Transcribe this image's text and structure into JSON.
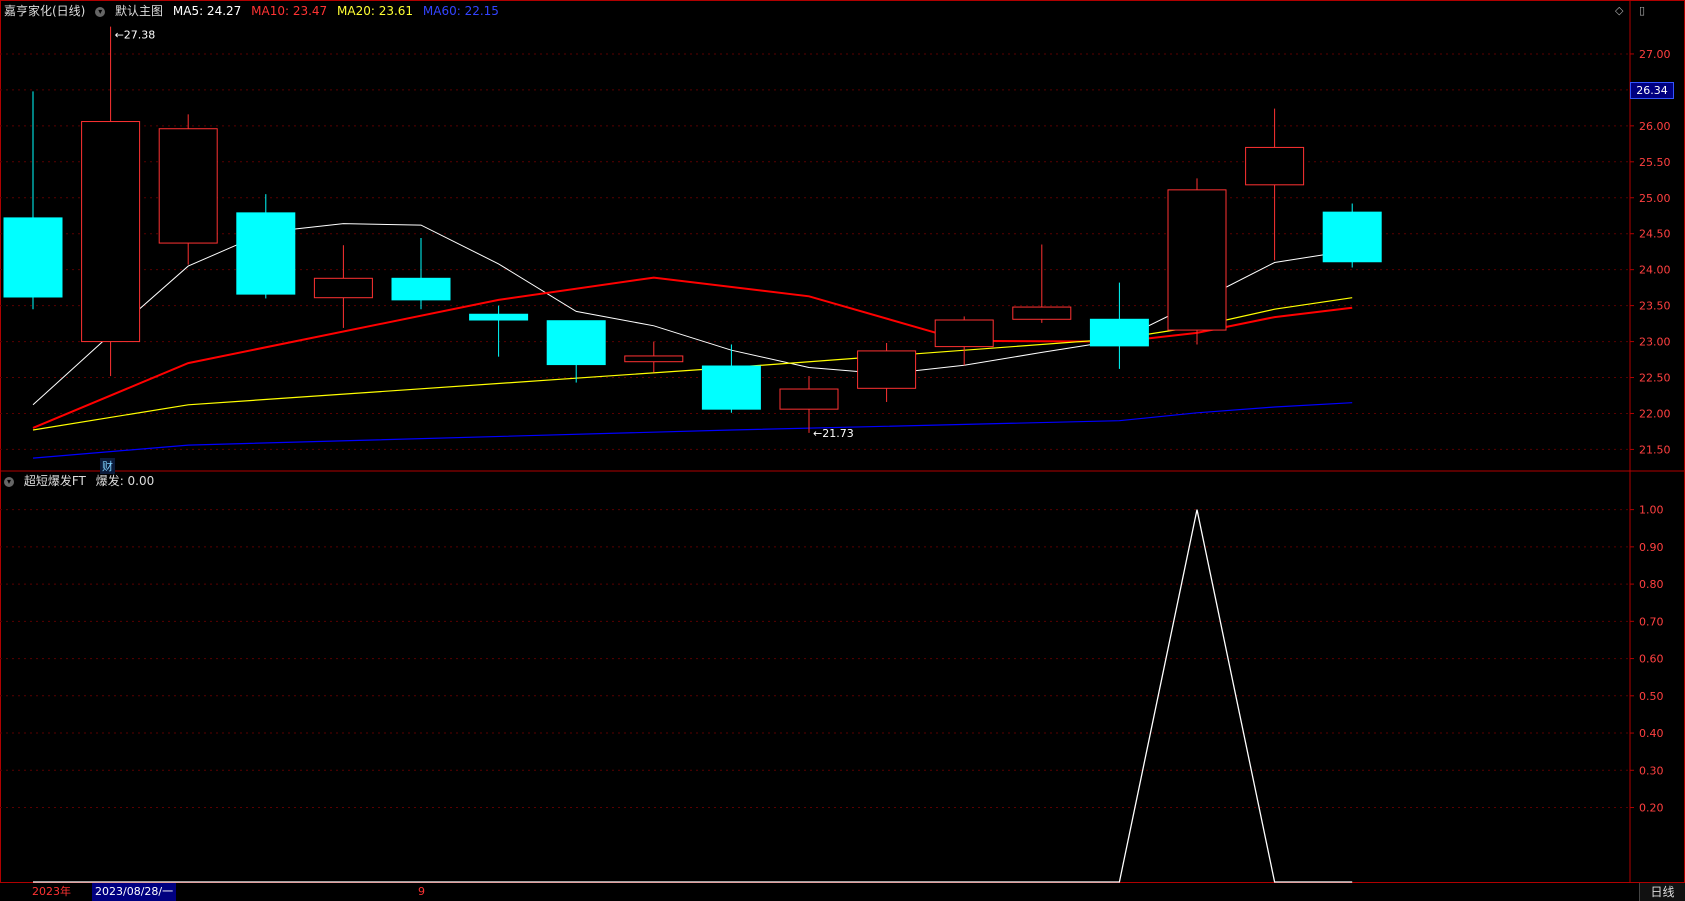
{
  "header": {
    "stock_name": "嘉亨家化(日线)",
    "main_chart_label": "默认主图",
    "ma5": "MA5: 24.27",
    "ma10": "MA10: 23.47",
    "ma20": "MA20: 23.61",
    "ma60": "MA60: 22.15"
  },
  "indicator": {
    "name": "超短爆发FT",
    "value": "爆发: 0.00"
  },
  "last_price_tag": "26.34",
  "corner_icons": [
    "diamond-icon",
    "window-icon"
  ],
  "financial_marker": "财",
  "bottom": {
    "year_label": "2023年",
    "date_label": "2023/08/28/一",
    "month_label": "9",
    "period": "日线"
  },
  "colors": {
    "background": "#000000",
    "up": "#ff3232",
    "down": "#00ffff",
    "ma5": "#ffffff",
    "ma10": "#ff0000",
    "ma20": "#ffff00",
    "ma60": "#0000ff",
    "axis": "#b00000"
  },
  "chart_data": [
    {
      "type": "candlestick",
      "title": "嘉亨家化(日线)",
      "ylim": [
        21.2,
        27.5
      ],
      "y_ticks": [
        21.5,
        22.0,
        22.5,
        23.0,
        23.5,
        24.0,
        24.5,
        25.0,
        25.5,
        26.0,
        26.5,
        27.0
      ],
      "y_tick_labels": [
        "21.50",
        "22.00",
        "22.50",
        "23.00",
        "23.50",
        "24.00",
        "24.50",
        "25.00",
        "25.50",
        "26.00",
        "26.50",
        "27.00"
      ],
      "candles": [
        {
          "open": 24.72,
          "high": 26.48,
          "low": 23.45,
          "close": 23.62
        },
        {
          "open": 23.0,
          "high": 27.38,
          "low": 22.52,
          "close": 26.06
        },
        {
          "open": 24.37,
          "high": 26.16,
          "low": 24.07,
          "close": 25.96
        },
        {
          "open": 24.79,
          "high": 25.05,
          "low": 23.6,
          "close": 23.66
        },
        {
          "open": 23.61,
          "high": 24.34,
          "low": 23.19,
          "close": 23.88
        },
        {
          "open": 23.88,
          "high": 24.44,
          "low": 23.45,
          "close": 23.58
        },
        {
          "open": 23.38,
          "high": 23.5,
          "low": 22.79,
          "close": 23.3
        },
        {
          "open": 23.29,
          "high": 23.29,
          "low": 22.43,
          "close": 22.68
        },
        {
          "open": 22.72,
          "high": 23.0,
          "low": 22.57,
          "close": 22.8
        },
        {
          "open": 22.66,
          "high": 22.96,
          "low": 22.01,
          "close": 22.06
        },
        {
          "open": 22.06,
          "high": 22.52,
          "low": 21.73,
          "close": 22.34
        },
        {
          "open": 22.35,
          "high": 22.98,
          "low": 22.16,
          "close": 22.87
        },
        {
          "open": 22.93,
          "high": 23.35,
          "low": 22.67,
          "close": 23.3
        },
        {
          "open": 23.31,
          "high": 24.35,
          "low": 23.26,
          "close": 23.48
        },
        {
          "open": 23.31,
          "high": 23.82,
          "low": 22.62,
          "close": 22.94
        },
        {
          "open": 23.16,
          "high": 25.27,
          "low": 22.96,
          "close": 25.11
        },
        {
          "open": 25.18,
          "high": 26.24,
          "low": 24.13,
          "close": 25.7
        },
        {
          "open": 24.8,
          "high": 24.92,
          "low": 24.03,
          "close": 24.11
        }
      ],
      "series": [
        {
          "name": "MA5",
          "values": [
            22.12,
            23.1,
            24.05,
            24.52,
            24.64,
            24.62,
            24.08,
            23.42,
            23.22,
            22.88,
            22.64,
            22.55,
            22.67,
            22.85,
            23.02,
            23.55,
            24.1,
            24.27
          ]
        },
        {
          "name": "MA10",
          "values": [
            21.8,
            null,
            22.7,
            null,
            null,
            null,
            23.58,
            null,
            23.89,
            null,
            23.63,
            null,
            23.01,
            null,
            23.0,
            23.12,
            23.34,
            23.47
          ]
        },
        {
          "name": "MA20",
          "values": [
            21.77,
            null,
            22.12,
            null,
            null,
            null,
            null,
            null,
            null,
            22.64,
            null,
            null,
            null,
            null,
            23.04,
            23.21,
            23.45,
            23.61
          ]
        },
        {
          "name": "MA60",
          "values": [
            21.38,
            null,
            21.56,
            null,
            null,
            null,
            null,
            null,
            null,
            21.77,
            null,
            null,
            null,
            null,
            21.9,
            22.01,
            22.09,
            22.15
          ]
        }
      ],
      "annotations": [
        {
          "text": "27.38",
          "index": 1,
          "value": 27.38
        },
        {
          "text": "21.73",
          "index": 10,
          "value": 21.73
        }
      ]
    },
    {
      "type": "line",
      "title": "超短爆发FT",
      "ylim": [
        0.0,
        1.05
      ],
      "y_ticks": [
        0.2,
        0.3,
        0.4,
        0.5,
        0.6,
        0.7,
        0.8,
        0.9,
        1.0
      ],
      "y_tick_labels": [
        "0.20",
        "0.30",
        "0.40",
        "0.50",
        "0.60",
        "0.70",
        "0.80",
        "0.90",
        "1.00"
      ],
      "series": [
        {
          "name": "爆发",
          "values": [
            0,
            0,
            0,
            0,
            0,
            0,
            0,
            0,
            0,
            0,
            0,
            0,
            0,
            0,
            0,
            1,
            0,
            0
          ]
        }
      ]
    }
  ]
}
